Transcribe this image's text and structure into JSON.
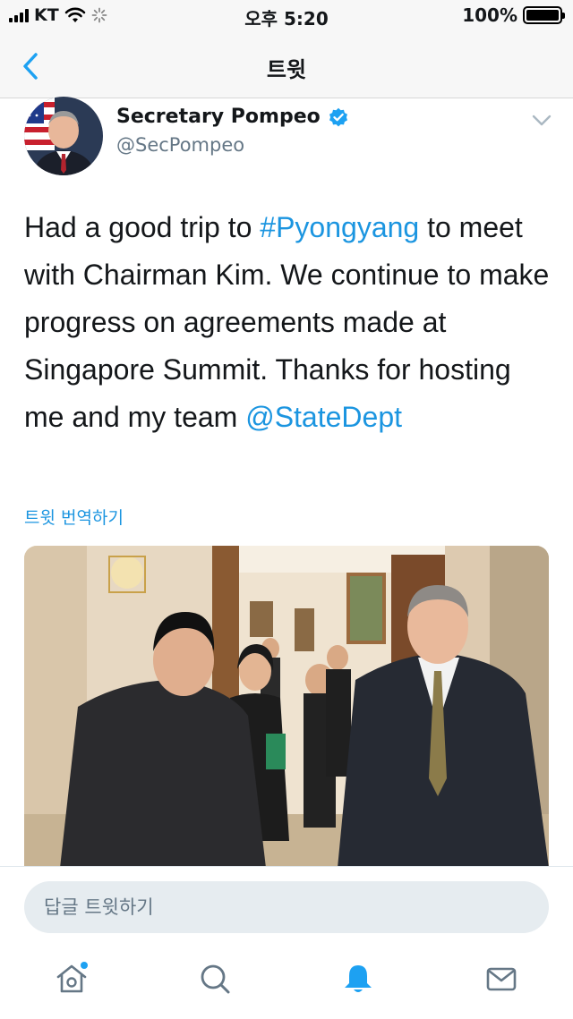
{
  "status_bar": {
    "carrier": "KT",
    "time": "오후 5:20",
    "battery": "100%",
    "battery_level": 1.0
  },
  "nav": {
    "title": "트윗",
    "back_icon": "chevron-left-icon"
  },
  "tweet": {
    "display_name": "Secretary Pompeo",
    "handle": "@SecPompeo",
    "verified": true,
    "text_segments": [
      {
        "text": "Had a good trip to ",
        "type": "plain"
      },
      {
        "text": "#Pyongyang",
        "type": "link"
      },
      {
        "text": " to meet with Chairman Kim.  We continue to make progress on agreements made at Singapore Summit.  Thanks for hosting me and my team ",
        "type": "plain"
      },
      {
        "text": "@StateDept",
        "type": "link"
      }
    ],
    "translate_label": "트윗 번역하기"
  },
  "reply": {
    "placeholder": "답글 트윗하기"
  },
  "tab_bar": {
    "items": [
      {
        "icon": "home-icon",
        "has_notification_dot": true
      },
      {
        "icon": "search-icon"
      },
      {
        "icon": "bell-icon",
        "active": true
      },
      {
        "icon": "mail-icon"
      }
    ]
  },
  "colors": {
    "accent": "#1da1f2",
    "link": "#1b95e0",
    "text": "#14171a",
    "secondary": "#657786"
  }
}
